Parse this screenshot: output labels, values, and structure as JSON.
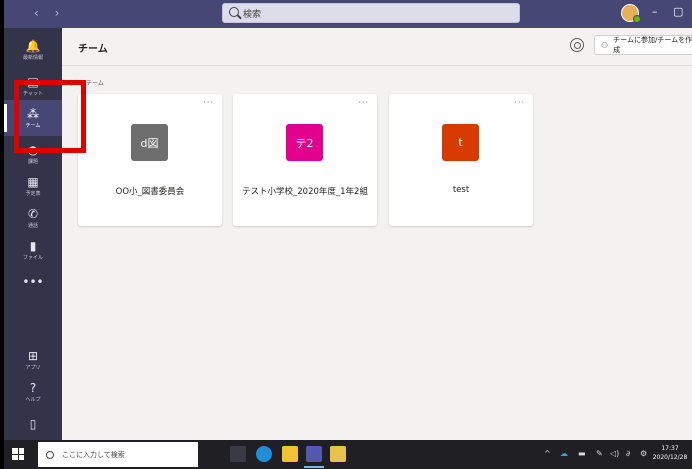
{
  "titlebar": {
    "nav_arrows": "‹ ›",
    "search_placeholder": "検索",
    "minimize": "–",
    "maximize": "▢"
  },
  "rail": {
    "items": [
      {
        "label": "最新情報",
        "icon": "bell-icon",
        "glyph": "🔔"
      },
      {
        "label": "チャット",
        "icon": "chat-icon",
        "glyph": "▤"
      },
      {
        "label": "チーム",
        "icon": "teams-icon",
        "glyph": "⁂",
        "active": true
      },
      {
        "label": "課題",
        "icon": "assignments-icon",
        "glyph": "◓"
      },
      {
        "label": "予定表",
        "icon": "calendar-icon",
        "glyph": "▦"
      },
      {
        "label": "通話",
        "icon": "phone-icon",
        "glyph": "✆"
      },
      {
        "label": "ファイル",
        "icon": "file-icon",
        "glyph": "▮"
      },
      {
        "label": "",
        "icon": "more-icon",
        "glyph": "•••"
      },
      {
        "label": "アプリ",
        "icon": "apps-icon",
        "glyph": "⊞"
      },
      {
        "label": "ヘルプ",
        "icon": "help-icon",
        "glyph": "?"
      },
      {
        "label": "",
        "icon": "device-icon",
        "glyph": "▯"
      }
    ]
  },
  "header": {
    "title": "チーム",
    "join_button": "チームに参加/チームを作成"
  },
  "section_label": "あなたのチーム",
  "teams": [
    {
      "name": "OO小_図書委員会",
      "initials": "d図",
      "color": "#6e6e6e"
    },
    {
      "name": "テスト小学校_2020年度_1年2組",
      "initials": "テ2",
      "color": "#e3008c"
    },
    {
      "name": "test",
      "initials": "t",
      "color": "#d83b01"
    }
  ],
  "card_more": "···",
  "taskbar": {
    "search_placeholder": "ここに入力して検索",
    "time": "17:37",
    "date": "2020/12/28"
  },
  "colors": {
    "titlebar": "#464775",
    "rail": "#33344a",
    "highlight": "#e00000"
  }
}
